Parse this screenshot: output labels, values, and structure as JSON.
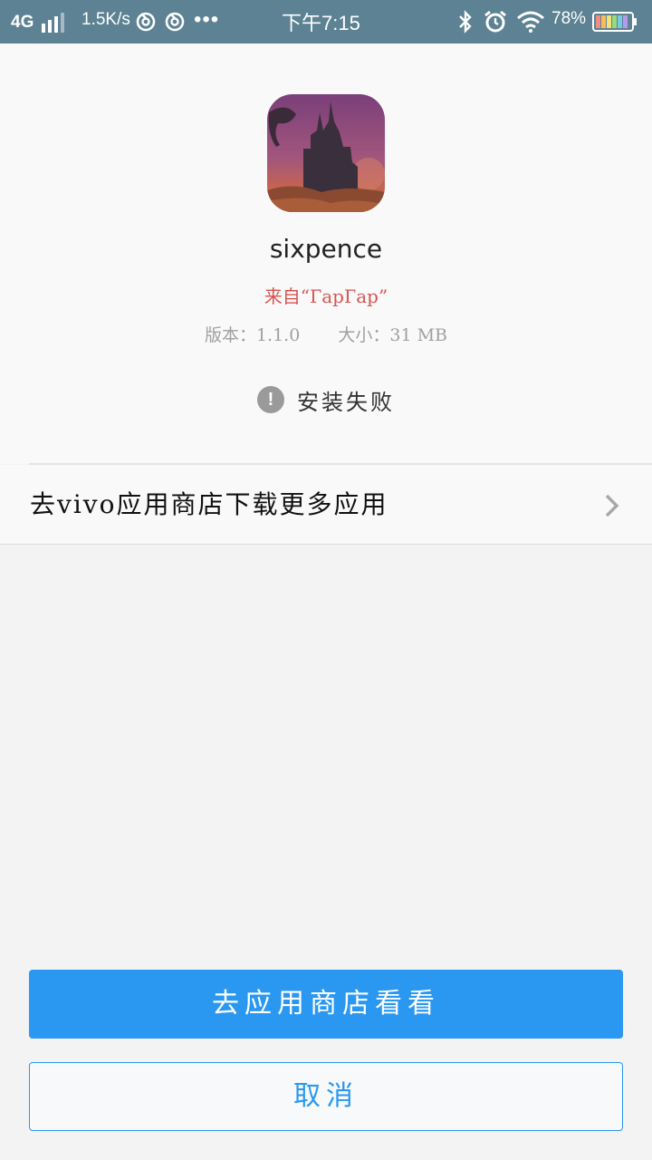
{
  "status_bar": {
    "network": "4G",
    "speed": "1.5K/s",
    "dots": "•••",
    "time": "下午7:15",
    "battery_pct": "78%"
  },
  "app": {
    "name": "sixpence",
    "source": "来自“ГарГар”",
    "version": "版本：1.1.0",
    "size": "大小：31 MB",
    "install_status": "安装失败",
    "status_icon_glyph": "!"
  },
  "store_link": {
    "label": "去vivo应用商店下载更多应用"
  },
  "buttons": {
    "primary": "去应用商店看看",
    "secondary": "取消"
  },
  "colors": {
    "status_bar": "#5c8293",
    "accent": "#2a98f0",
    "source_text": "#d9534f"
  }
}
